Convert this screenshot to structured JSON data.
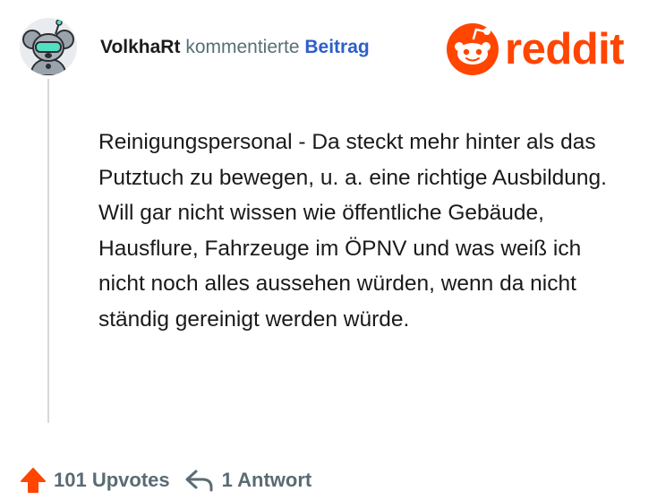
{
  "header": {
    "username": "VolkhaRt",
    "action": "kommentierte",
    "post_link": "Beitrag"
  },
  "brand": {
    "logo_text": "reddit",
    "color": "#ff4500"
  },
  "comment": {
    "body": "Reinigungspersonal - Da steckt mehr hinter als das Putztuch zu bewegen, u. a. eine richtige Ausbildung. Will gar nicht wissen wie öffentliche Gebäude, Hausflure, Fahrzeuge im ÖPNV und was weiß ich nicht noch alles aussehen würden, wenn da nicht ständig gereinigt werden würde."
  },
  "footer": {
    "upvotes": "101 Upvotes",
    "replies": "1 Antwort",
    "upvote_icon": "upvote-arrow-icon",
    "reply_icon": "reply-arrow-icon"
  },
  "colors": {
    "accent": "#ff4500",
    "link": "#2d5fc8",
    "muted": "#576f76",
    "thread_line": "#d6d9dc"
  }
}
